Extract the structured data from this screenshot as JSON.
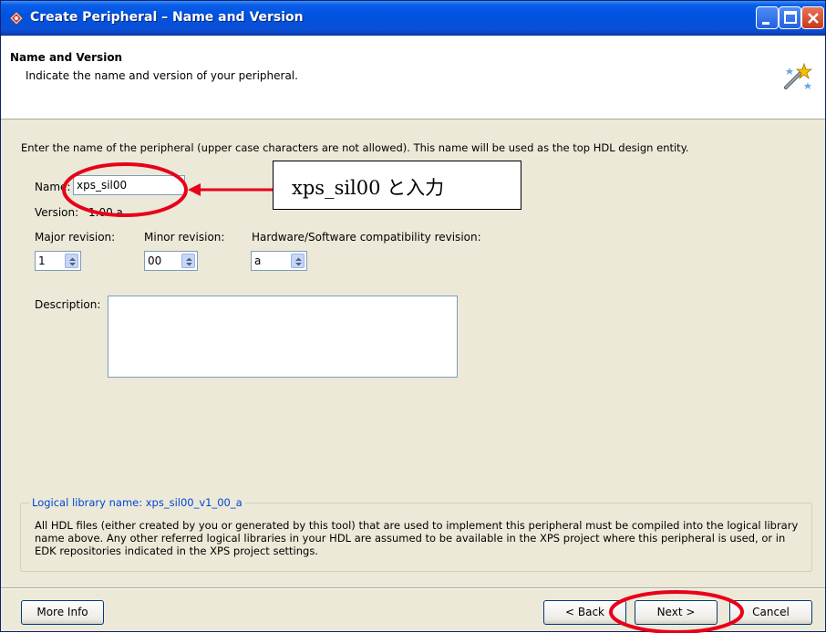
{
  "window": {
    "title": "Create Peripheral – Name and Version",
    "title_icon": "wizard-app-icon",
    "controls": [
      "minimize-icon",
      "maximize-icon",
      "close-icon"
    ]
  },
  "header": {
    "title": "Name and Version",
    "subtitle": "Indicate the name and version of your peripheral.",
    "icon": "wizard-wand-icon"
  },
  "form": {
    "intro": "Enter the name of the peripheral (upper case characters are not allowed). This name will be used as the top HDL design entity.",
    "name_label": "Name:",
    "name_value": "xps_sil00",
    "version_label": "Version:",
    "version_value": "1.00.a",
    "major_label": "Major revision:",
    "major_value": "1",
    "minor_label": "Minor revision:",
    "minor_value": "00",
    "hw_label": "Hardware/Software compatibility revision:",
    "hw_value": "a",
    "description_label": "Description:",
    "description_value": ""
  },
  "annotation": {
    "callout_text": "xps_sil00 と入力",
    "highlight_color": "#e8001a"
  },
  "library": {
    "legend": "Logical library name: xps_sil00_v1_00_a",
    "text": "All HDL files (either created by you or generated by this tool) that are used to implement this peripheral must be compiled into the logical library name above. Any other referred logical libraries in your HDL are assumed to be available in the XPS project where this peripheral is used, or in EDK repositories indicated in the XPS project settings."
  },
  "buttons": {
    "more_info": "More Info",
    "back": "< Back",
    "next": "Next >",
    "cancel": "Cancel"
  }
}
